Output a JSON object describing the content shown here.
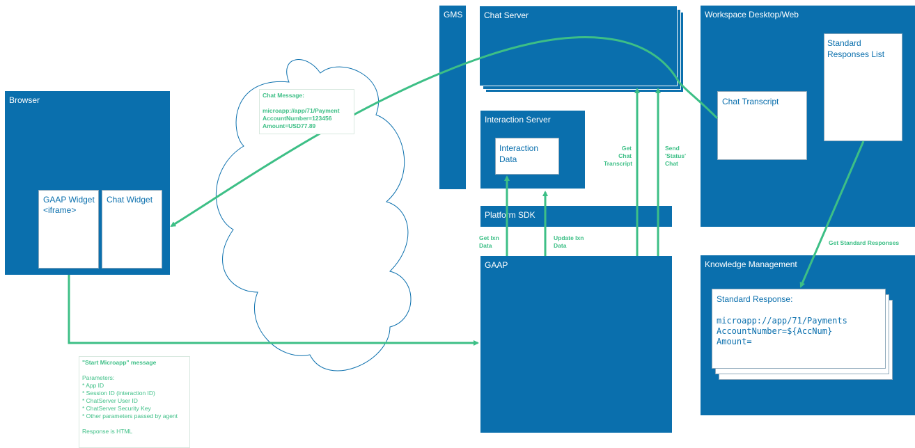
{
  "colors": {
    "box": "#0a6fad",
    "arrow": "#3dbf86",
    "note_text": "#3dbf86"
  },
  "browser": {
    "title": "Browser",
    "gaap_widget": "GAAP Widget\n<iframe>",
    "chat_widget": "Chat Widget"
  },
  "gms": {
    "title": "GMS"
  },
  "chat_server": {
    "title": "Chat Server"
  },
  "interaction_server": {
    "title": "Interaction Server",
    "data_label": "Interaction\nData"
  },
  "platform_sdk": {
    "title": "Platform SDK"
  },
  "gaap": {
    "title": "GAAP"
  },
  "workspace": {
    "title": "Workspace Desktop/Web",
    "chat_transcript": "Chat Transcript",
    "standard_responses_list": "Standard\nResponses List"
  },
  "knowledge_management": {
    "title": "Knowledge Management",
    "response_title": "Standard Response:",
    "response_body": "microapp://app/71/Payments\nAccountNumber=${AccNum}\nAmount="
  },
  "chat_message": {
    "heading": "Chat Message:",
    "body": "microapp://app/71/Payment\nAccountNumber=123456\nAmount=USD77.89"
  },
  "labels": {
    "get_chat_transcript": "Get\nChat\nTranscript",
    "send_status_chat": "Send\n'Status'\nChat",
    "get_ixn_data": "Get Ixn\nData",
    "update_ixn_data": "Update Ixn\nData",
    "get_standard_responses": "Get Standard Responses"
  },
  "start_microapp": {
    "heading": "\"Start Microapp\" message",
    "params_title": "Parameters:",
    "params": "* App ID\n* Session ID  (interaction ID)\n* ChatServer User ID\n* ChatServer Security Key\n* Other parameters passed by agent",
    "response": "Response is HTML"
  }
}
